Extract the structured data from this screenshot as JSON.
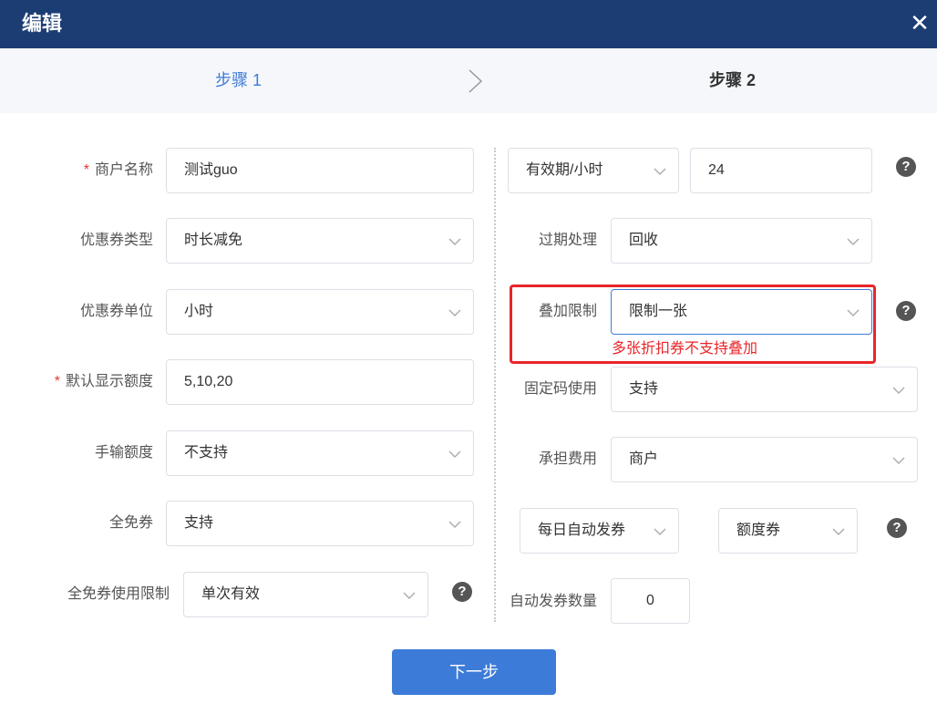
{
  "dialog": {
    "title": "编辑"
  },
  "steps": {
    "step1": "步骤 1",
    "step2": "步骤 2"
  },
  "left": {
    "merchant_name": {
      "label": "商户名称",
      "required": "*",
      "value": "测试guo"
    },
    "coupon_type": {
      "label": "优惠券类型",
      "value": "时长减免"
    },
    "coupon_unit": {
      "label": "优惠券单位",
      "value": "小时"
    },
    "default_amounts": {
      "label": "默认显示额度",
      "required": "*",
      "value": "5,10,20"
    },
    "manual_amount": {
      "label": "手输额度",
      "value": "不支持"
    },
    "full_free": {
      "label": "全免券",
      "value": "支持"
    },
    "full_free_limit": {
      "label": "全免券使用限制",
      "value": "单次有效"
    }
  },
  "right": {
    "validity": {
      "unit": "有效期/小时",
      "value": "24"
    },
    "expiry_handling": {
      "label": "过期处理",
      "value": "回收"
    },
    "stack_limit": {
      "label": "叠加限制",
      "value": "限制一张",
      "error": "多张折扣券不支持叠加"
    },
    "fixed_code": {
      "label": "固定码使用",
      "value": "支持"
    },
    "cost_bearer": {
      "label": "承担费用",
      "value": "商户"
    },
    "auto_issue": {
      "frequency": "每日自动发券",
      "coupon_kind": "额度券"
    },
    "auto_issue_count": {
      "label": "自动发券数量",
      "value": "0"
    }
  },
  "footer": {
    "next": "下一步"
  },
  "help_glyph": "?",
  "close_glyph": "✕",
  "colors": {
    "header": "#1c3d74",
    "accent": "#3d7bd8",
    "error": "#e8262a"
  }
}
